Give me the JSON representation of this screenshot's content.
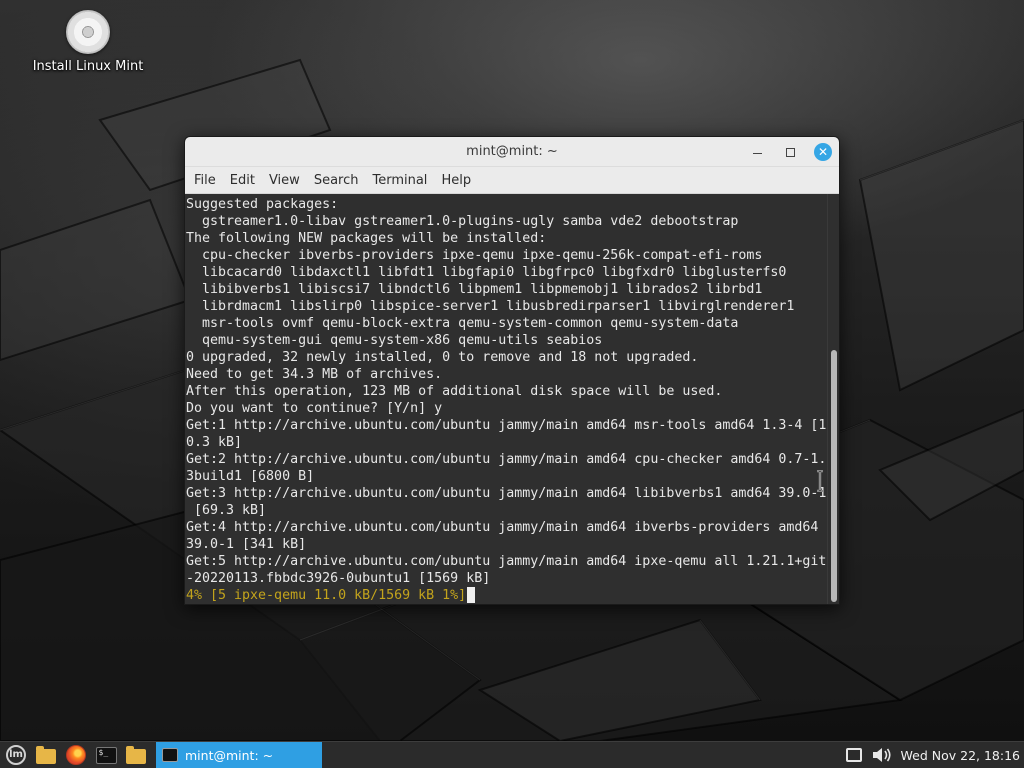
{
  "desktop": {
    "icons": [
      {
        "label": "Install Linux Mint",
        "icon": "disc-icon"
      }
    ]
  },
  "window": {
    "title": "mint@mint: ~",
    "controls": {
      "minimize": "minimize-icon",
      "maximize": "maximize-icon",
      "close_glyph": "✕"
    },
    "menu": [
      "File",
      "Edit",
      "View",
      "Search",
      "Terminal",
      "Help"
    ],
    "terminal": {
      "lines": [
        "Suggested packages:",
        "  gstreamer1.0-libav gstreamer1.0-plugins-ugly samba vde2 debootstrap",
        "The following NEW packages will be installed:",
        "  cpu-checker ibverbs-providers ipxe-qemu ipxe-qemu-256k-compat-efi-roms",
        "  libcacard0 libdaxctl1 libfdt1 libgfapi0 libgfrpc0 libgfxdr0 libglusterfs0",
        "  libibverbs1 libiscsi7 libndctl6 libpmem1 libpmemobj1 librados2 librbd1",
        "  librdmacm1 libslirp0 libspice-server1 libusbredirparser1 libvirglrenderer1",
        "  msr-tools ovmf qemu-block-extra qemu-system-common qemu-system-data",
        "  qemu-system-gui qemu-system-x86 qemu-utils seabios",
        "0 upgraded, 32 newly installed, 0 to remove and 18 not upgraded.",
        "Need to get 34.3 MB of archives.",
        "After this operation, 123 MB of additional disk space will be used.",
        "Do you want to continue? [Y/n] y",
        "Get:1 http://archive.ubuntu.com/ubuntu jammy/main amd64 msr-tools amd64 1.3-4 [1",
        "0.3 kB]",
        "Get:2 http://archive.ubuntu.com/ubuntu jammy/main amd64 cpu-checker amd64 0.7-1.",
        "3build1 [6800 B]",
        "Get:3 http://archive.ubuntu.com/ubuntu jammy/main amd64 libibverbs1 amd64 39.0-1",
        " [69.3 kB]",
        "Get:4 http://archive.ubuntu.com/ubuntu jammy/main amd64 ibverbs-providers amd64",
        "39.0-1 [341 kB]",
        "Get:5 http://archive.ubuntu.com/ubuntu jammy/main amd64 ipxe-qemu all 1.21.1+git",
        "-20220113.fbbdc3926-0ubuntu1 [1569 kB]"
      ],
      "progress_line": "4% [5 ipxe-qemu 11.0 kB/1569 kB 1%]",
      "progress_color": "#c3a41c",
      "background": "#2f2f2f",
      "foreground": "#e8e8e8"
    }
  },
  "taskbar": {
    "launchers": [
      {
        "name": "menu-button",
        "icon": "mint-logo-icon",
        "glyph": "lm"
      },
      {
        "name": "files-launcher",
        "icon": "folder-icon"
      },
      {
        "name": "firefox-launcher",
        "icon": "firefox-icon"
      },
      {
        "name": "terminal-launcher",
        "icon": "terminal-icon",
        "glyph": "$_"
      },
      {
        "name": "files-launcher-2",
        "icon": "folder-icon"
      }
    ],
    "task": {
      "label": "mint@mint: ~",
      "icon": "terminal-icon",
      "active_color": "#2f9fe3"
    },
    "tray": {
      "network": "network-icon",
      "volume": "volume-icon",
      "clock": "Wed Nov 22, 18:16"
    }
  }
}
